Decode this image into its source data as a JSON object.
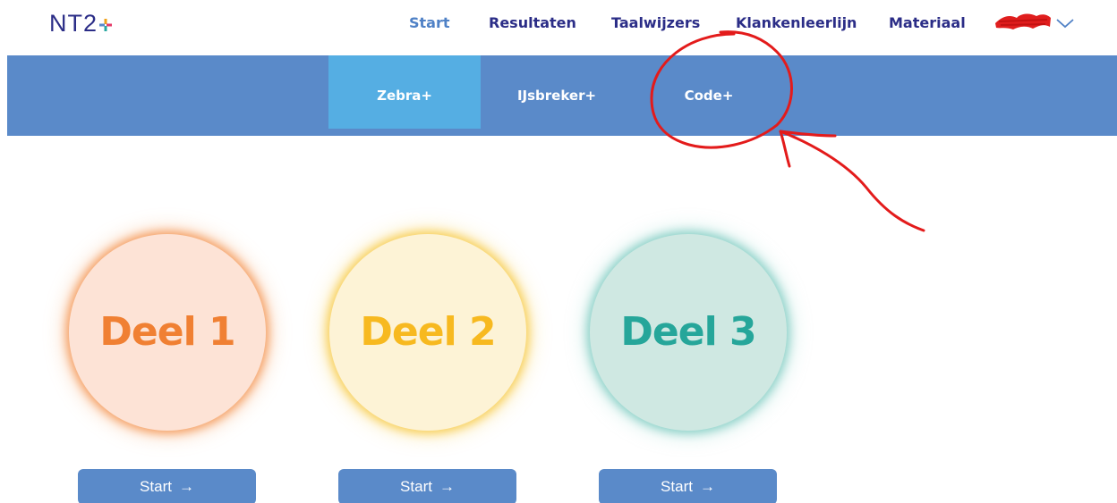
{
  "brand": {
    "logo_text": "NT2",
    "plus_colors": [
      "#f0a21a",
      "#e53a68",
      "#27a7a0",
      "#5a8ac9"
    ]
  },
  "nav": {
    "items": [
      {
        "label": "Start",
        "active": true
      },
      {
        "label": "Resultaten",
        "active": false
      },
      {
        "label": "Taalwijzers",
        "active": false
      },
      {
        "label": "Klankenleerlijn",
        "active": false
      },
      {
        "label": "Materiaal",
        "active": false
      }
    ],
    "user_menu_icon": "chevron-down-icon"
  },
  "subnav": {
    "tabs": [
      {
        "label": "Zebra+",
        "active": true
      },
      {
        "label": "IJsbreker+",
        "active": false
      },
      {
        "label": "Code+",
        "active": false
      }
    ]
  },
  "parts": [
    {
      "label": "Deel 1",
      "color": "#f08033",
      "fill": "#fde3d6",
      "glow": "#f5a064",
      "start_label": "Start"
    },
    {
      "label": "Deel 2",
      "color": "#f7b920",
      "fill": "#fdf3d6",
      "glow": "#f8d05a",
      "start_label": "Start"
    },
    {
      "label": "Deel 3",
      "color": "#26a69a",
      "fill": "#cfe8e2",
      "glow": "#8ed2c9",
      "start_label": "Start"
    }
  ],
  "colors": {
    "brand_blue": "#2b2d87",
    "active_blue": "#4f81c6",
    "band_blue": "#5a8ac9",
    "active_tab": "#55aee3",
    "annotation_red": "#e31b1b"
  }
}
